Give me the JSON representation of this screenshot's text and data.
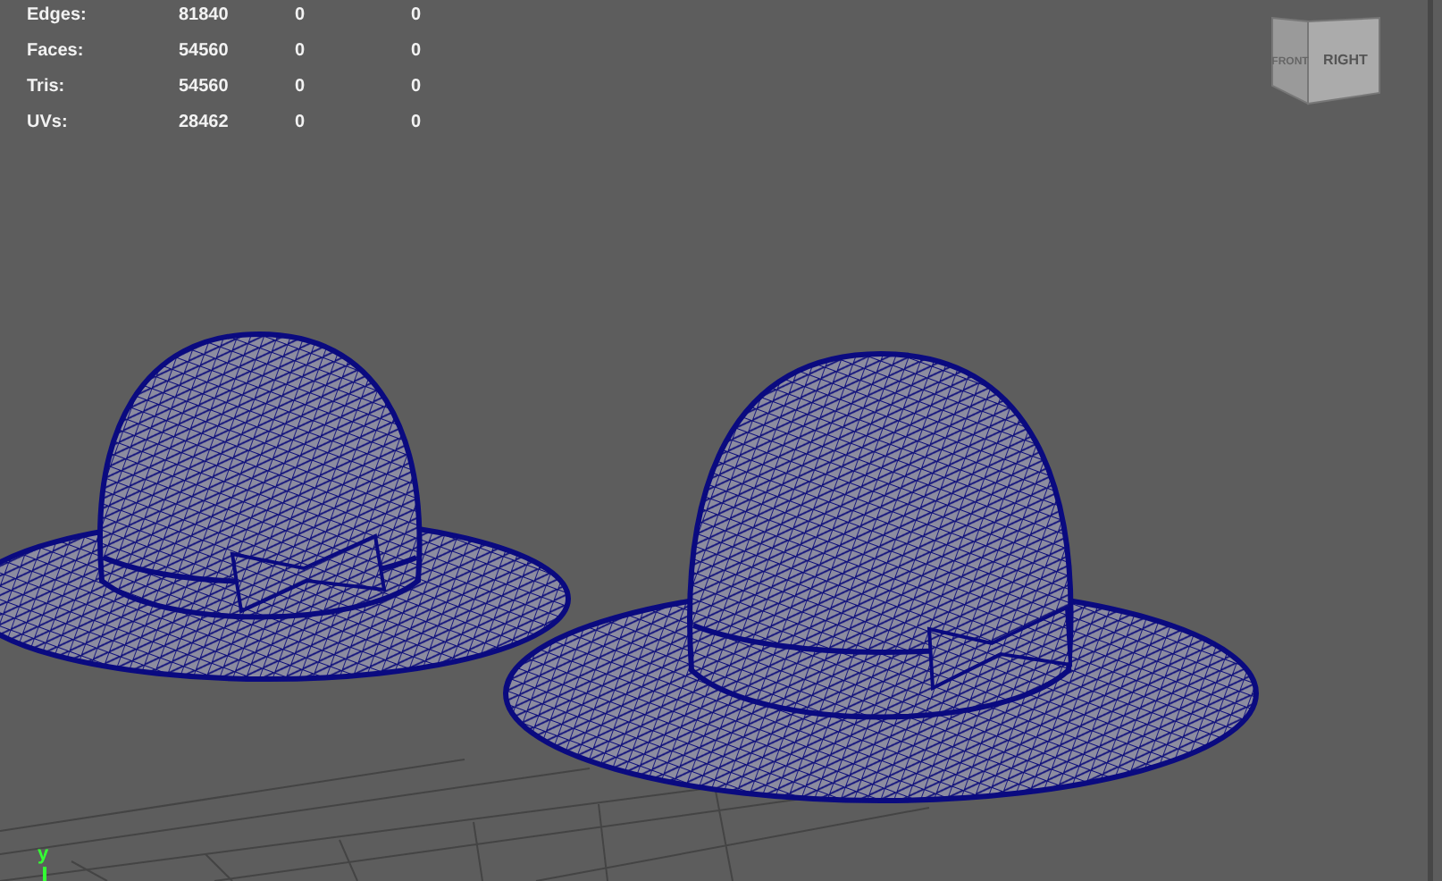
{
  "stats": [
    {
      "label": "Edges:",
      "values": [
        "81840",
        "0",
        "0"
      ]
    },
    {
      "label": "Faces:",
      "values": [
        "54560",
        "0",
        "0"
      ]
    },
    {
      "label": "Tris:",
      "values": [
        "54560",
        "0",
        "0"
      ]
    },
    {
      "label": "UVs:",
      "values": [
        "28462",
        "0",
        "0"
      ]
    }
  ],
  "view_cube": {
    "faces": [
      "FRONT",
      "RIGHT"
    ]
  },
  "axis_label": "y"
}
